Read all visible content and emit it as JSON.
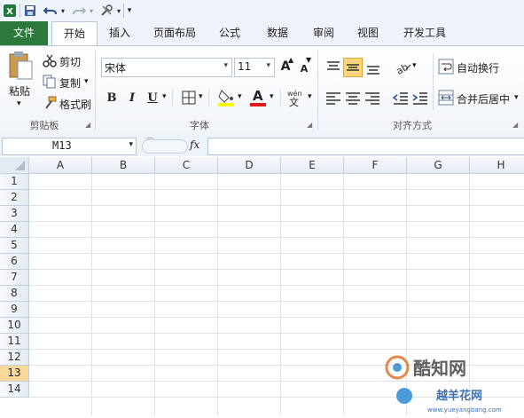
{
  "tabs": {
    "file": "文件",
    "home": "开始",
    "insert": "插入",
    "layout": "页面布局",
    "formula": "公式",
    "data": "数据",
    "review": "审阅",
    "view": "视图",
    "developer": "开发工具"
  },
  "clipboard": {
    "paste": "粘贴",
    "cut": "剪切",
    "copy": "复制",
    "format_painter": "格式刷",
    "group_label": "剪贴板"
  },
  "font": {
    "name": "宋体",
    "size": "11",
    "bold": "B",
    "italic": "I",
    "underline": "U",
    "grow": "A",
    "shrink": "A",
    "color_letter": "A",
    "group_label": "字体"
  },
  "alignment": {
    "wrap_text": "自动换行",
    "merge_center": "合并后居中",
    "group_label": "对齐方式"
  },
  "formula_bar": {
    "name_box": "M13",
    "fx": "fx",
    "value": ""
  },
  "grid": {
    "columns": [
      "A",
      "B",
      "C",
      "D",
      "E",
      "F",
      "G",
      "H"
    ],
    "rows": [
      "1",
      "2",
      "3",
      "4",
      "5",
      "6",
      "7",
      "8",
      "9",
      "10",
      "11",
      "12",
      "13",
      "14"
    ],
    "selected_row": "13"
  },
  "watermark": {
    "brand": "酷知网",
    "site": "越羊花网",
    "url": "www.yueyangbang.com"
  },
  "colors": {
    "file_tab": "#2b7a3b",
    "selected_row": "#f9d99a",
    "ribbon_bg": "#f0f4f9"
  }
}
